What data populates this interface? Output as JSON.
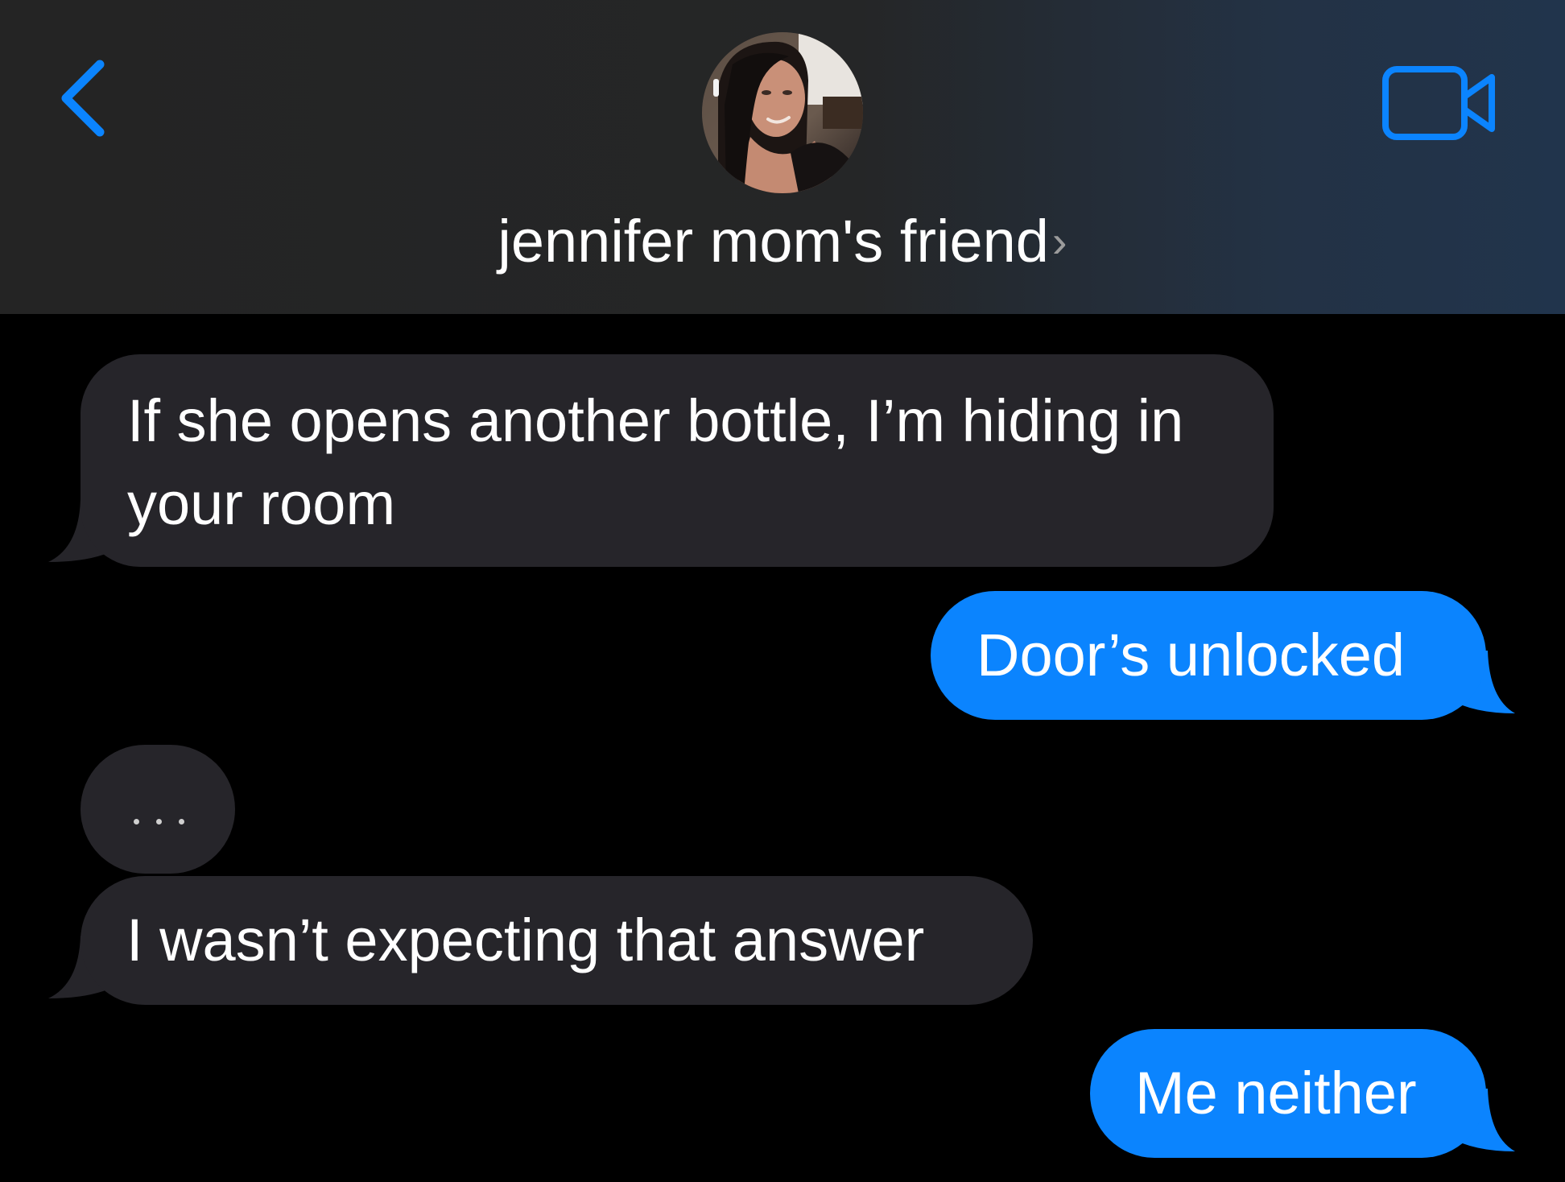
{
  "header": {
    "contact_name": "jennifer mom's friend",
    "name_chevron": "›",
    "back_icon": "chevron-left-icon",
    "video_icon": "video-camera-icon",
    "accent_color": "#0b84fe"
  },
  "colors": {
    "incoming_bubble": "#26252a",
    "outgoing_bubble": "#0b84fe",
    "background": "#000000"
  },
  "messages": [
    {
      "direction": "incoming",
      "text": "If she opens another bottle, I’m hiding in your room"
    },
    {
      "direction": "outgoing",
      "text": "Door’s unlocked"
    },
    {
      "direction": "incoming",
      "type": "typing-indicator"
    },
    {
      "direction": "incoming",
      "text": "I wasn’t expecting that answer"
    },
    {
      "direction": "outgoing",
      "text": "Me neither"
    }
  ]
}
